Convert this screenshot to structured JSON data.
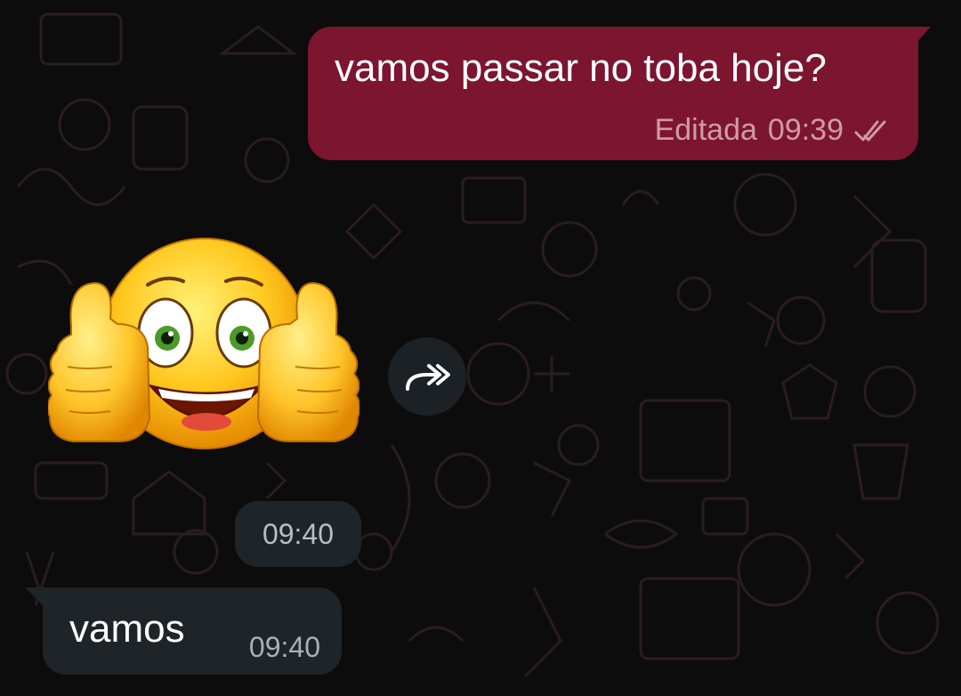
{
  "colors": {
    "background": "#0c0c0c",
    "outgoing_bubble": "#7c1530",
    "incoming_bubble": "#1e2428",
    "forward_button": "#1c2126"
  },
  "messages": [
    {
      "direction": "outgoing",
      "text": "vamos passar no toba hoje?",
      "edited_label": "Editada",
      "time": "09:39",
      "status_icon": "double-check-icon"
    },
    {
      "direction": "incoming",
      "type": "sticker",
      "sticker_icon": "thumbs-up-smiley-sticker",
      "action_icon": "forward-icon",
      "time": "09:40"
    },
    {
      "direction": "incoming",
      "text": "vamos",
      "time": "09:40"
    }
  ]
}
